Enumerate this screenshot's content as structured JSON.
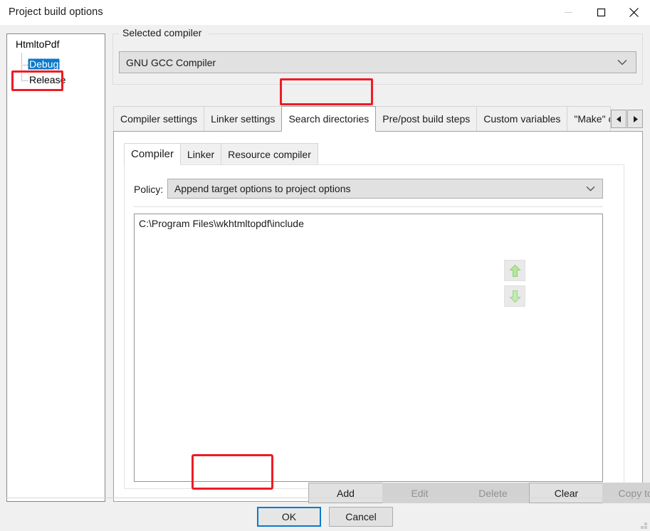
{
  "window": {
    "title": "Project build options",
    "controls": [
      {
        "name": "minimize-button",
        "glyph": "minimize"
      },
      {
        "name": "maximize-button",
        "glyph": "maximize"
      },
      {
        "name": "close-button",
        "glyph": "close"
      }
    ]
  },
  "tree": {
    "root": "HtmltoPdf",
    "children": [
      {
        "label": "Debug",
        "selected": true
      },
      {
        "label": "Release",
        "selected": false
      }
    ]
  },
  "compiler_group": {
    "legend": "Selected compiler",
    "selected": "GNU GCC Compiler",
    "arrow_icon": "chevron-down-icon"
  },
  "outer_tabs": {
    "items": [
      {
        "label": "Compiler settings",
        "active": false
      },
      {
        "label": "Linker settings",
        "active": false
      },
      {
        "label": "Search directories",
        "active": true
      },
      {
        "label": "Pre/post build steps",
        "active": false
      },
      {
        "label": "Custom variables",
        "active": false
      },
      {
        "label": "\"Make\" c",
        "active": false,
        "clipped": true
      }
    ],
    "scroll_left": "◄",
    "scroll_right": "►"
  },
  "inner_tabs": {
    "items": [
      {
        "label": "Compiler",
        "active": true
      },
      {
        "label": "Linker",
        "active": false
      },
      {
        "label": "Resource compiler",
        "active": false
      }
    ]
  },
  "policy": {
    "label": "Policy:",
    "value": "Append target options to project options",
    "arrow_icon": "chevron-down-icon"
  },
  "directories": {
    "items": [
      "C:\\Program Files\\wkhtmltopdf\\include"
    ]
  },
  "side_arrows": [
    {
      "name": "move-up-button",
      "icon": "arrow-up-icon",
      "enabled": false
    },
    {
      "name": "move-down-button",
      "icon": "arrow-down-icon",
      "enabled": false
    }
  ],
  "action_buttons": [
    {
      "label": "Add",
      "enabled": true
    },
    {
      "label": "Edit",
      "enabled": false
    },
    {
      "label": "Delete",
      "enabled": false
    },
    {
      "label": "Clear",
      "enabled": true
    },
    {
      "label": "Copy to...",
      "enabled": false
    }
  ],
  "footer": {
    "ok": "OK",
    "cancel": "Cancel"
  },
  "annotations": {
    "highlight_color": "#ed1c24",
    "targets": [
      "Debug",
      "Search directories",
      "Add"
    ]
  }
}
